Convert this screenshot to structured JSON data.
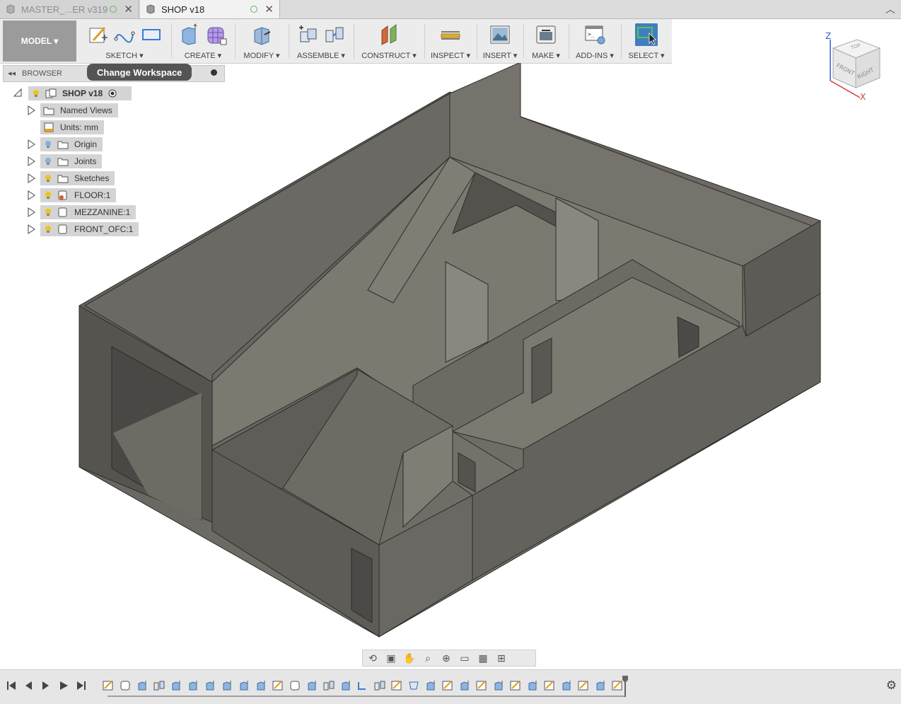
{
  "tabs": [
    {
      "label": "MASTER_...ER v319",
      "active": false
    },
    {
      "label": "SHOP v18",
      "active": true
    }
  ],
  "toolbar": {
    "workspace_label": "MODEL ▾",
    "groups": [
      {
        "label": "SKETCH ▾",
        "icons": [
          "sketch-create-icon",
          "arc-icon",
          "rectangle-icon"
        ]
      },
      {
        "label": "CREATE ▾",
        "icons": [
          "extrude-icon",
          "form-icon"
        ]
      },
      {
        "label": "MODIFY ▾",
        "icons": [
          "press-pull-icon"
        ]
      },
      {
        "label": "ASSEMBLE ▾",
        "icons": [
          "new-component-icon",
          "joint-icon"
        ]
      },
      {
        "label": "CONSTRUCT ▾",
        "icons": [
          "offset-plane-icon"
        ]
      },
      {
        "label": "INSPECT ▾",
        "icons": [
          "measure-icon"
        ]
      },
      {
        "label": "INSERT ▾",
        "icons": [
          "insert-image-icon"
        ]
      },
      {
        "label": "MAKE ▾",
        "icons": [
          "3d-print-icon"
        ]
      },
      {
        "label": "ADD-INS ▾",
        "icons": [
          "scripts-icon"
        ]
      },
      {
        "label": "SELECT ▾",
        "icons": [
          "select-window-icon"
        ]
      }
    ]
  },
  "tooltip": "Change Workspace",
  "browser": {
    "title": "BROWSER",
    "root": "SHOP v18",
    "items": [
      {
        "label": "Named Views",
        "icon": "folder-icon",
        "bulb": false
      },
      {
        "label": "Units: mm",
        "icon": "units-icon",
        "bulb": false
      },
      {
        "label": "Origin",
        "icon": "folder-icon",
        "bulb": "off"
      },
      {
        "label": "Joints",
        "icon": "folder-icon",
        "bulb": "off"
      },
      {
        "label": "Sketches",
        "icon": "folder-icon",
        "bulb": "on"
      },
      {
        "label": "FLOOR:1",
        "icon": "component-link-icon",
        "bulb": "on"
      },
      {
        "label": "MEZZANINE:1",
        "icon": "component-icon",
        "bulb": "on"
      },
      {
        "label": "FRONT_OFC:1",
        "icon": "component-icon",
        "bulb": "on"
      }
    ]
  },
  "viewcube": {
    "top": "TOP",
    "front": "FRONT",
    "right": "RIGHT",
    "z": "Z",
    "x": "X"
  },
  "colors": {
    "accent": "#3f7fbf",
    "bulb_on": "#f2c21b",
    "bulb_off": "#7fb3e0",
    "model": "#6f6c66"
  },
  "timeline": {
    "feature_count": 31
  }
}
